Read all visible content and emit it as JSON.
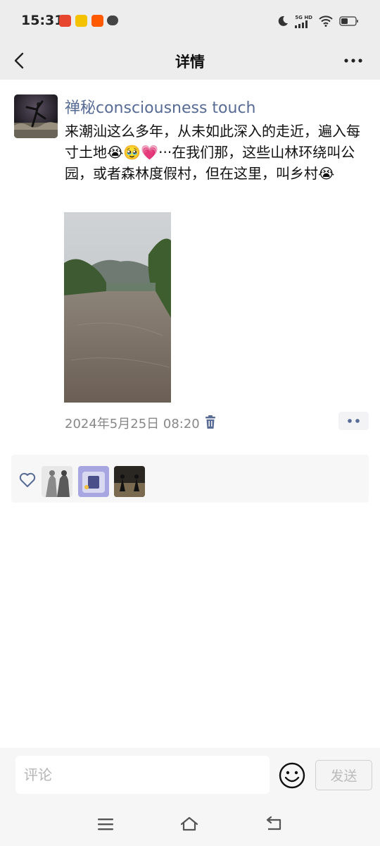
{
  "status_bar": {
    "time": "15:31",
    "network": "5G HD"
  },
  "nav": {
    "title": "详情"
  },
  "post": {
    "user_name": "禅秘consciousness touch",
    "text": "来潮汕这么多年，从未如此深入的走近，遍入每寸土地😭🥹💗···在我们那，这些山林环绕叫公园，或者森林度假村，但在这里，叫乡村😭",
    "timestamp": "2024年5月25日 08:20"
  },
  "comment": {
    "placeholder": "评论",
    "send_label": "发送"
  },
  "colors": {
    "user_name": "#576b95",
    "header_bg": "#ededed",
    "like_bg": "#f7f7f7"
  },
  "icons": [
    "back-arrow-icon",
    "more-icon",
    "trash-icon",
    "heart-icon",
    "emoji-icon",
    "menu-icon",
    "home-icon",
    "back-nav-icon"
  ]
}
